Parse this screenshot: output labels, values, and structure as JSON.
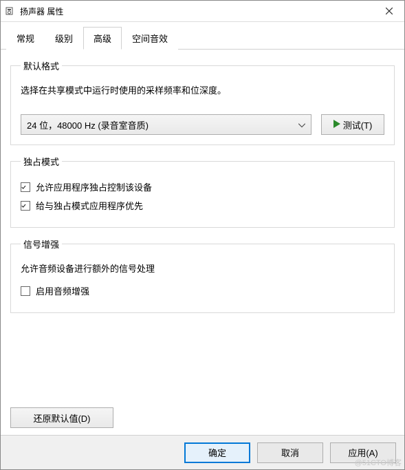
{
  "window": {
    "title": "扬声器 属性"
  },
  "tabs": [
    "常规",
    "级别",
    "高级",
    "空间音效"
  ],
  "active_tab_index": 2,
  "groups": {
    "default_format": {
      "legend": "默认格式",
      "desc": "选择在共享模式中运行时使用的采样频率和位深度。",
      "selected": "24 位，48000 Hz (录音室音质)",
      "test_btn": "测试(T)"
    },
    "exclusive": {
      "legend": "独占模式",
      "opt1": {
        "label": "允许应用程序独占控制该设备",
        "checked": true
      },
      "opt2": {
        "label": "给与独占模式应用程序优先",
        "checked": true
      }
    },
    "enhance": {
      "legend": "信号增强",
      "desc": "允许音频设备进行额外的信号处理",
      "opt": {
        "label": "启用音频增强",
        "checked": false
      }
    }
  },
  "restore_btn": "还原默认值(D)",
  "footer": {
    "ok": "确定",
    "cancel": "取消",
    "apply": "应用(A)"
  },
  "watermark": "@51CTO博客"
}
